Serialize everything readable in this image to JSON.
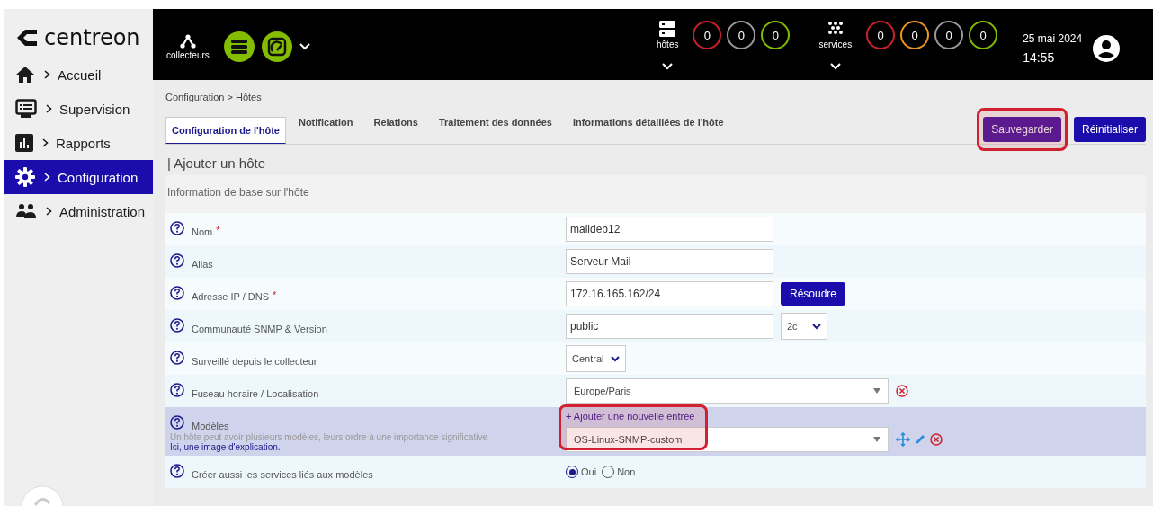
{
  "sidebar": {
    "logo": "centreon",
    "items": [
      {
        "label": "Accueil",
        "selected": false
      },
      {
        "label": "Supervision",
        "selected": false
      },
      {
        "label": "Rapports",
        "selected": false
      },
      {
        "label": "Configuration",
        "selected": true
      },
      {
        "label": "Administration",
        "selected": false
      }
    ]
  },
  "header": {
    "pollers": {
      "label": "collecteurs"
    },
    "hosts": {
      "label": "hôtes",
      "counts": [
        {
          "value": "0",
          "color": "#d0202a"
        },
        {
          "value": "0",
          "color": "#9a9a9a"
        },
        {
          "value": "0",
          "color": "#84bd00"
        }
      ]
    },
    "services": {
      "label": "services",
      "counts": [
        {
          "value": "0",
          "color": "#d0202a"
        },
        {
          "value": "0",
          "color": "#f0961e"
        },
        {
          "value": "0",
          "color": "#9a9a9a"
        },
        {
          "value": "0",
          "color": "#84bd00"
        }
      ]
    },
    "date": "25 mai 2024",
    "time": "14:55"
  },
  "breadcrumb": "Configuration  >  Hôtes",
  "tabs": [
    {
      "label": "Configuration de l'hôte",
      "selected": true
    },
    {
      "label": "Notification",
      "selected": false
    },
    {
      "label": "Relations",
      "selected": false
    },
    {
      "label": "Traitement des données",
      "selected": false
    },
    {
      "label": "Informations détaillées de l'hôte",
      "selected": false
    }
  ],
  "buttons": [
    {
      "label": "Sauvegarder",
      "highlighted": true
    },
    {
      "label": "Réinitialiser",
      "highlighted": false
    }
  ],
  "section_title": "| Ajouter un hôte",
  "subsection": "Information de base sur l'hôte",
  "fields": [
    {
      "kind": "text",
      "label": "Nom",
      "required_mark": "*",
      "value": "maildeb12"
    },
    {
      "kind": "text",
      "label": "Alias",
      "value": "Serveur Mail"
    },
    {
      "kind": "text_button",
      "label": "Adresse IP / DNS",
      "required_mark": "*",
      "value": "172.16.165.162/24",
      "button": "Résoudre"
    },
    {
      "kind": "text_select",
      "label": "Communauté SNMP & Version",
      "value": "public",
      "select": "2c"
    },
    {
      "kind": "select",
      "label": "Surveillé depuis le collecteur",
      "value": "Central"
    },
    {
      "kind": "combo",
      "label": "Fuseau horaire / Localisation",
      "value": "Europe/Paris"
    },
    {
      "kind": "templates",
      "label": "Modèles",
      "help": "Un hôte peut avoir plusieurs modèles, leurs ordre à une importance significative",
      "link": "Ici, une image d'explication.",
      "add": "+ Ajouter une nouvelle entrée",
      "highlighted": true,
      "entries": [
        {
          "value": "OS-Linux-SNMP-custom"
        }
      ]
    },
    {
      "kind": "radio",
      "label": "Créer aussi les services liés aux modèles",
      "options": [
        {
          "label": "Oui",
          "selected": true
        },
        {
          "label": "Non",
          "selected": false
        }
      ]
    }
  ]
}
